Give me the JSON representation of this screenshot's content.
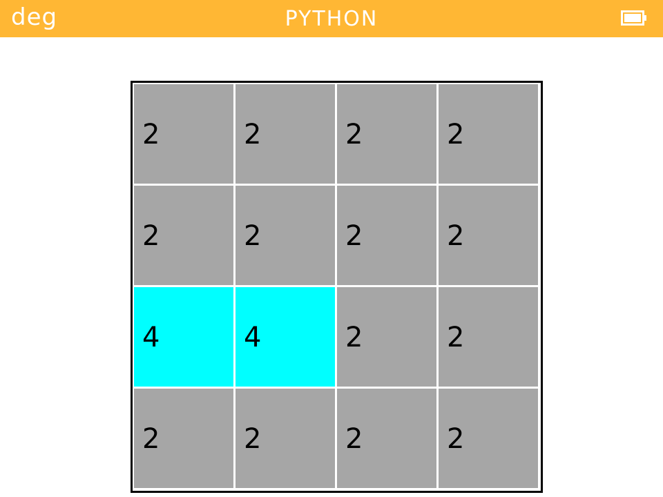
{
  "status_bar": {
    "angle_mode": "deg",
    "app_title": "PYTHON",
    "battery_icon": "battery-full-icon",
    "background_color": "#ffb734",
    "text_color": "#ffffff"
  },
  "board": {
    "border_color": "#000000",
    "cell_color": "#a6a6a6",
    "highlight_color": "#00ffff",
    "rows": [
      [
        {
          "value": "2",
          "highlight": false
        },
        {
          "value": "2",
          "highlight": false
        },
        {
          "value": "2",
          "highlight": false
        },
        {
          "value": "2",
          "highlight": false
        }
      ],
      [
        {
          "value": "2",
          "highlight": false
        },
        {
          "value": "2",
          "highlight": false
        },
        {
          "value": "2",
          "highlight": false
        },
        {
          "value": "2",
          "highlight": false
        }
      ],
      [
        {
          "value": "4",
          "highlight": true
        },
        {
          "value": "4",
          "highlight": true
        },
        {
          "value": "2",
          "highlight": false
        },
        {
          "value": "2",
          "highlight": false
        }
      ],
      [
        {
          "value": "2",
          "highlight": false
        },
        {
          "value": "2",
          "highlight": false
        },
        {
          "value": "2",
          "highlight": false
        },
        {
          "value": "2",
          "highlight": false
        }
      ]
    ]
  }
}
